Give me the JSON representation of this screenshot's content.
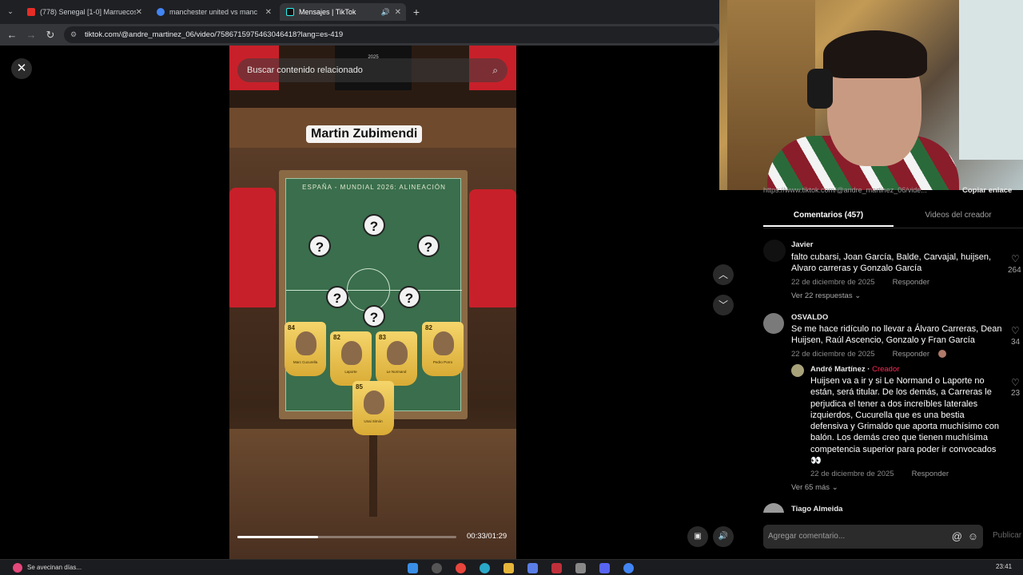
{
  "browser": {
    "tabs": [
      {
        "label": "(778) Senegal [1-0] Marruecos",
        "active": false,
        "favicon_color": "#e52d27"
      },
      {
        "label": "manchester united vs manches",
        "active": false,
        "favicon_color": "#4285f4"
      },
      {
        "label": "Mensajes | TikTok",
        "active": true,
        "favicon_color": "#111111"
      }
    ],
    "url": "tiktok.com/@andre_martinez_06/video/7586715975463046418?lang=es-419"
  },
  "video": {
    "search_placeholder": "Buscar contenido relacionado",
    "overlay_title": "Martin Zubimendi",
    "board_title": "ESPAÑA - MUNDIAL 2026: ALINEACIÓN",
    "wall_sign": "2025",
    "mystery_mark": "?",
    "cards": [
      {
        "rating": "84",
        "name": "Marc Cucurella"
      },
      {
        "rating": "82",
        "name": "Laporte"
      },
      {
        "rating": "83",
        "name": "Le Normand"
      },
      {
        "rating": "82",
        "name": "Pedro Porro"
      },
      {
        "rating": "85",
        "name": "Unai Simón"
      }
    ],
    "time": "00:33/01:29",
    "progress_fraction": 0.37
  },
  "side_panel": {
    "copy_url_text": "https://www.tiktok.com/@andre_martinez_06/vide...",
    "copy_button": "Copiar enlace",
    "tab_comments": "Comentarios (457)",
    "tab_creator_videos": "Videos del creador",
    "comments": [
      {
        "author": "Javier",
        "text": "falto cubarsi, Joan García, Balde, Carvajal, huijsen, Alvaro carreras y Gonzalo García",
        "date": "22 de diciembre de 2025",
        "reply": "Responder",
        "likes": "264",
        "more": "Ver 22 respuestas"
      },
      {
        "author": "OSVALDO",
        "text": "Se me hace ridículo no llevar a Álvaro Carreras, Dean Huijsen, Raúl Ascencio, Gonzalo y Fran García",
        "date": "22 de diciembre de 2025",
        "reply": "Responder",
        "likes": "34"
      },
      {
        "author": "André Martínez",
        "creator_tag": "Creador",
        "text": "Huijsen va a ir y si Le Normand o Laporte no están, será titular. De los demás, a Carreras le perjudica el tener a dos increíbles laterales izquierdos, Cucurella que es una bestia defensiva y Grimaldo que aporta muchísimo con balón. Los demás creo que tienen muchísima competencia superior para poder ir convocados👀",
        "date": "22 de diciembre de 2025",
        "reply": "Responder",
        "likes": "23",
        "more": "Ver 65 más"
      },
      {
        "author": "Tiago Almeida"
      }
    ],
    "comment_placeholder": "Agregar comentario...",
    "publish_label": "Publicar"
  },
  "taskbar": {
    "notification": "Se avecinan días...",
    "time": "23:41"
  },
  "colors": {
    "creator_tag": "#fe2c55",
    "active_tab_underline": "#ffffff",
    "progress": "#ffffff"
  },
  "icons": [
    "close-icon",
    "search-icon",
    "chevron-up-icon",
    "chevron-down-icon",
    "heart-icon",
    "volume-icon",
    "mention-icon",
    "emoji-icon",
    "pip-icon"
  ]
}
